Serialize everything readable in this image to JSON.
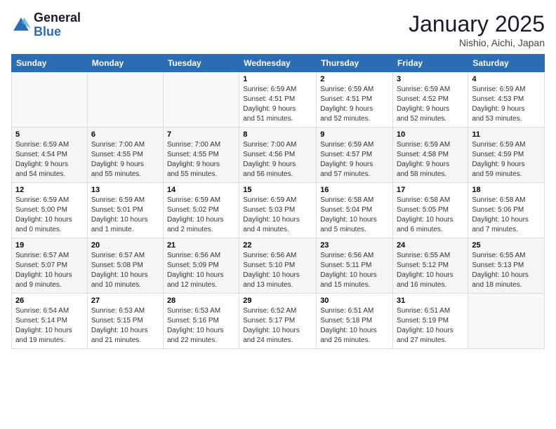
{
  "logo": {
    "line1": "General",
    "line2": "Blue"
  },
  "title": "January 2025",
  "subtitle": "Nishio, Aichi, Japan",
  "weekdays": [
    "Sunday",
    "Monday",
    "Tuesday",
    "Wednesday",
    "Thursday",
    "Friday",
    "Saturday"
  ],
  "weeks": [
    [
      {
        "day": "",
        "info": ""
      },
      {
        "day": "",
        "info": ""
      },
      {
        "day": "",
        "info": ""
      },
      {
        "day": "1",
        "info": "Sunrise: 6:59 AM\nSunset: 4:51 PM\nDaylight: 9 hours\nand 51 minutes."
      },
      {
        "day": "2",
        "info": "Sunrise: 6:59 AM\nSunset: 4:51 PM\nDaylight: 9 hours\nand 52 minutes."
      },
      {
        "day": "3",
        "info": "Sunrise: 6:59 AM\nSunset: 4:52 PM\nDaylight: 9 hours\nand 52 minutes."
      },
      {
        "day": "4",
        "info": "Sunrise: 6:59 AM\nSunset: 4:53 PM\nDaylight: 9 hours\nand 53 minutes."
      }
    ],
    [
      {
        "day": "5",
        "info": "Sunrise: 6:59 AM\nSunset: 4:54 PM\nDaylight: 9 hours\nand 54 minutes."
      },
      {
        "day": "6",
        "info": "Sunrise: 7:00 AM\nSunset: 4:55 PM\nDaylight: 9 hours\nand 55 minutes."
      },
      {
        "day": "7",
        "info": "Sunrise: 7:00 AM\nSunset: 4:55 PM\nDaylight: 9 hours\nand 55 minutes."
      },
      {
        "day": "8",
        "info": "Sunrise: 7:00 AM\nSunset: 4:56 PM\nDaylight: 9 hours\nand 56 minutes."
      },
      {
        "day": "9",
        "info": "Sunrise: 6:59 AM\nSunset: 4:57 PM\nDaylight: 9 hours\nand 57 minutes."
      },
      {
        "day": "10",
        "info": "Sunrise: 6:59 AM\nSunset: 4:58 PM\nDaylight: 9 hours\nand 58 minutes."
      },
      {
        "day": "11",
        "info": "Sunrise: 6:59 AM\nSunset: 4:59 PM\nDaylight: 9 hours\nand 59 minutes."
      }
    ],
    [
      {
        "day": "12",
        "info": "Sunrise: 6:59 AM\nSunset: 5:00 PM\nDaylight: 10 hours\nand 0 minutes."
      },
      {
        "day": "13",
        "info": "Sunrise: 6:59 AM\nSunset: 5:01 PM\nDaylight: 10 hours\nand 1 minute."
      },
      {
        "day": "14",
        "info": "Sunrise: 6:59 AM\nSunset: 5:02 PM\nDaylight: 10 hours\nand 2 minutes."
      },
      {
        "day": "15",
        "info": "Sunrise: 6:59 AM\nSunset: 5:03 PM\nDaylight: 10 hours\nand 4 minutes."
      },
      {
        "day": "16",
        "info": "Sunrise: 6:58 AM\nSunset: 5:04 PM\nDaylight: 10 hours\nand 5 minutes."
      },
      {
        "day": "17",
        "info": "Sunrise: 6:58 AM\nSunset: 5:05 PM\nDaylight: 10 hours\nand 6 minutes."
      },
      {
        "day": "18",
        "info": "Sunrise: 6:58 AM\nSunset: 5:06 PM\nDaylight: 10 hours\nand 7 minutes."
      }
    ],
    [
      {
        "day": "19",
        "info": "Sunrise: 6:57 AM\nSunset: 5:07 PM\nDaylight: 10 hours\nand 9 minutes."
      },
      {
        "day": "20",
        "info": "Sunrise: 6:57 AM\nSunset: 5:08 PM\nDaylight: 10 hours\nand 10 minutes."
      },
      {
        "day": "21",
        "info": "Sunrise: 6:56 AM\nSunset: 5:09 PM\nDaylight: 10 hours\nand 12 minutes."
      },
      {
        "day": "22",
        "info": "Sunrise: 6:56 AM\nSunset: 5:10 PM\nDaylight: 10 hours\nand 13 minutes."
      },
      {
        "day": "23",
        "info": "Sunrise: 6:56 AM\nSunset: 5:11 PM\nDaylight: 10 hours\nand 15 minutes."
      },
      {
        "day": "24",
        "info": "Sunrise: 6:55 AM\nSunset: 5:12 PM\nDaylight: 10 hours\nand 16 minutes."
      },
      {
        "day": "25",
        "info": "Sunrise: 6:55 AM\nSunset: 5:13 PM\nDaylight: 10 hours\nand 18 minutes."
      }
    ],
    [
      {
        "day": "26",
        "info": "Sunrise: 6:54 AM\nSunset: 5:14 PM\nDaylight: 10 hours\nand 19 minutes."
      },
      {
        "day": "27",
        "info": "Sunrise: 6:53 AM\nSunset: 5:15 PM\nDaylight: 10 hours\nand 21 minutes."
      },
      {
        "day": "28",
        "info": "Sunrise: 6:53 AM\nSunset: 5:16 PM\nDaylight: 10 hours\nand 22 minutes."
      },
      {
        "day": "29",
        "info": "Sunrise: 6:52 AM\nSunset: 5:17 PM\nDaylight: 10 hours\nand 24 minutes."
      },
      {
        "day": "30",
        "info": "Sunrise: 6:51 AM\nSunset: 5:18 PM\nDaylight: 10 hours\nand 26 minutes."
      },
      {
        "day": "31",
        "info": "Sunrise: 6:51 AM\nSunset: 5:19 PM\nDaylight: 10 hours\nand 27 minutes."
      },
      {
        "day": "",
        "info": ""
      }
    ]
  ]
}
